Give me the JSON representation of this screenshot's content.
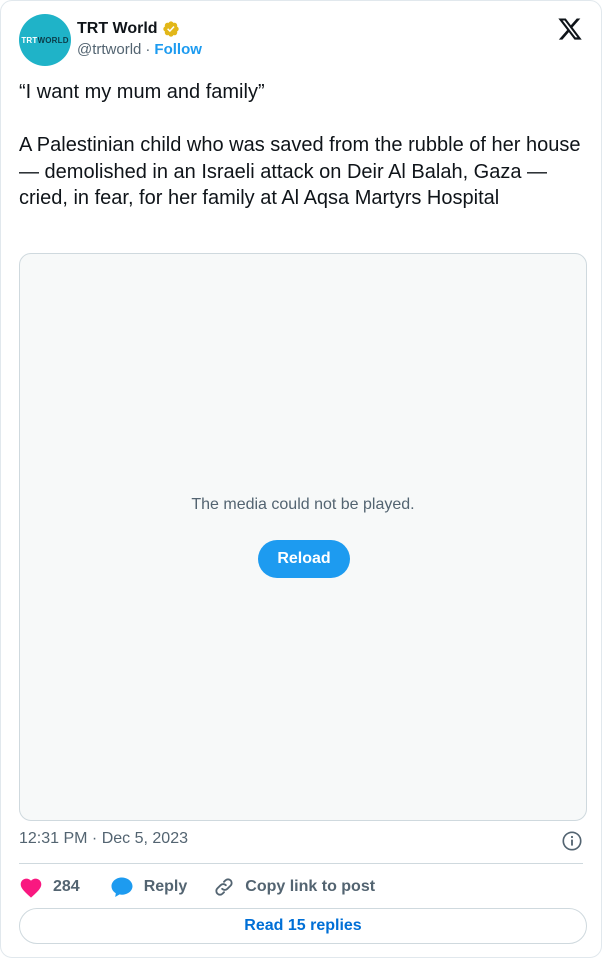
{
  "author": {
    "name": "TRT World",
    "handle": "@trtworld",
    "separator": "·",
    "follow_label": "Follow",
    "avatar_text_a": "TRT",
    "avatar_text_b": "WORLD",
    "verified_badge_color": "#e2b719",
    "avatar_color": "#1fb3c8"
  },
  "tweet": {
    "text": "“I want my mum and family”\n\nA Palestinian child who was saved from the rubble of her house — demolished in an Israeli attack on Deir Al Balah, Gaza — cried, in fear, for her family at Al Aqsa Martyrs Hospital",
    "timestamp": "12:31 PM · Dec 5, 2023"
  },
  "media": {
    "error_message": "The media could not be played.",
    "reload_label": "Reload"
  },
  "actions": {
    "like_count": "284",
    "reply_label": "Reply",
    "copy_link_label": "Copy link to post"
  },
  "footer": {
    "read_replies_label": "Read 15 replies"
  },
  "colors": {
    "accent": "#1d9bf0",
    "like": "#f91880",
    "link": "#006fd6",
    "muted": "#536471"
  },
  "icons": [
    "verified-badge-icon",
    "x-logo-icon",
    "info-icon",
    "heart-icon",
    "reply-bubble-icon",
    "link-icon"
  ]
}
